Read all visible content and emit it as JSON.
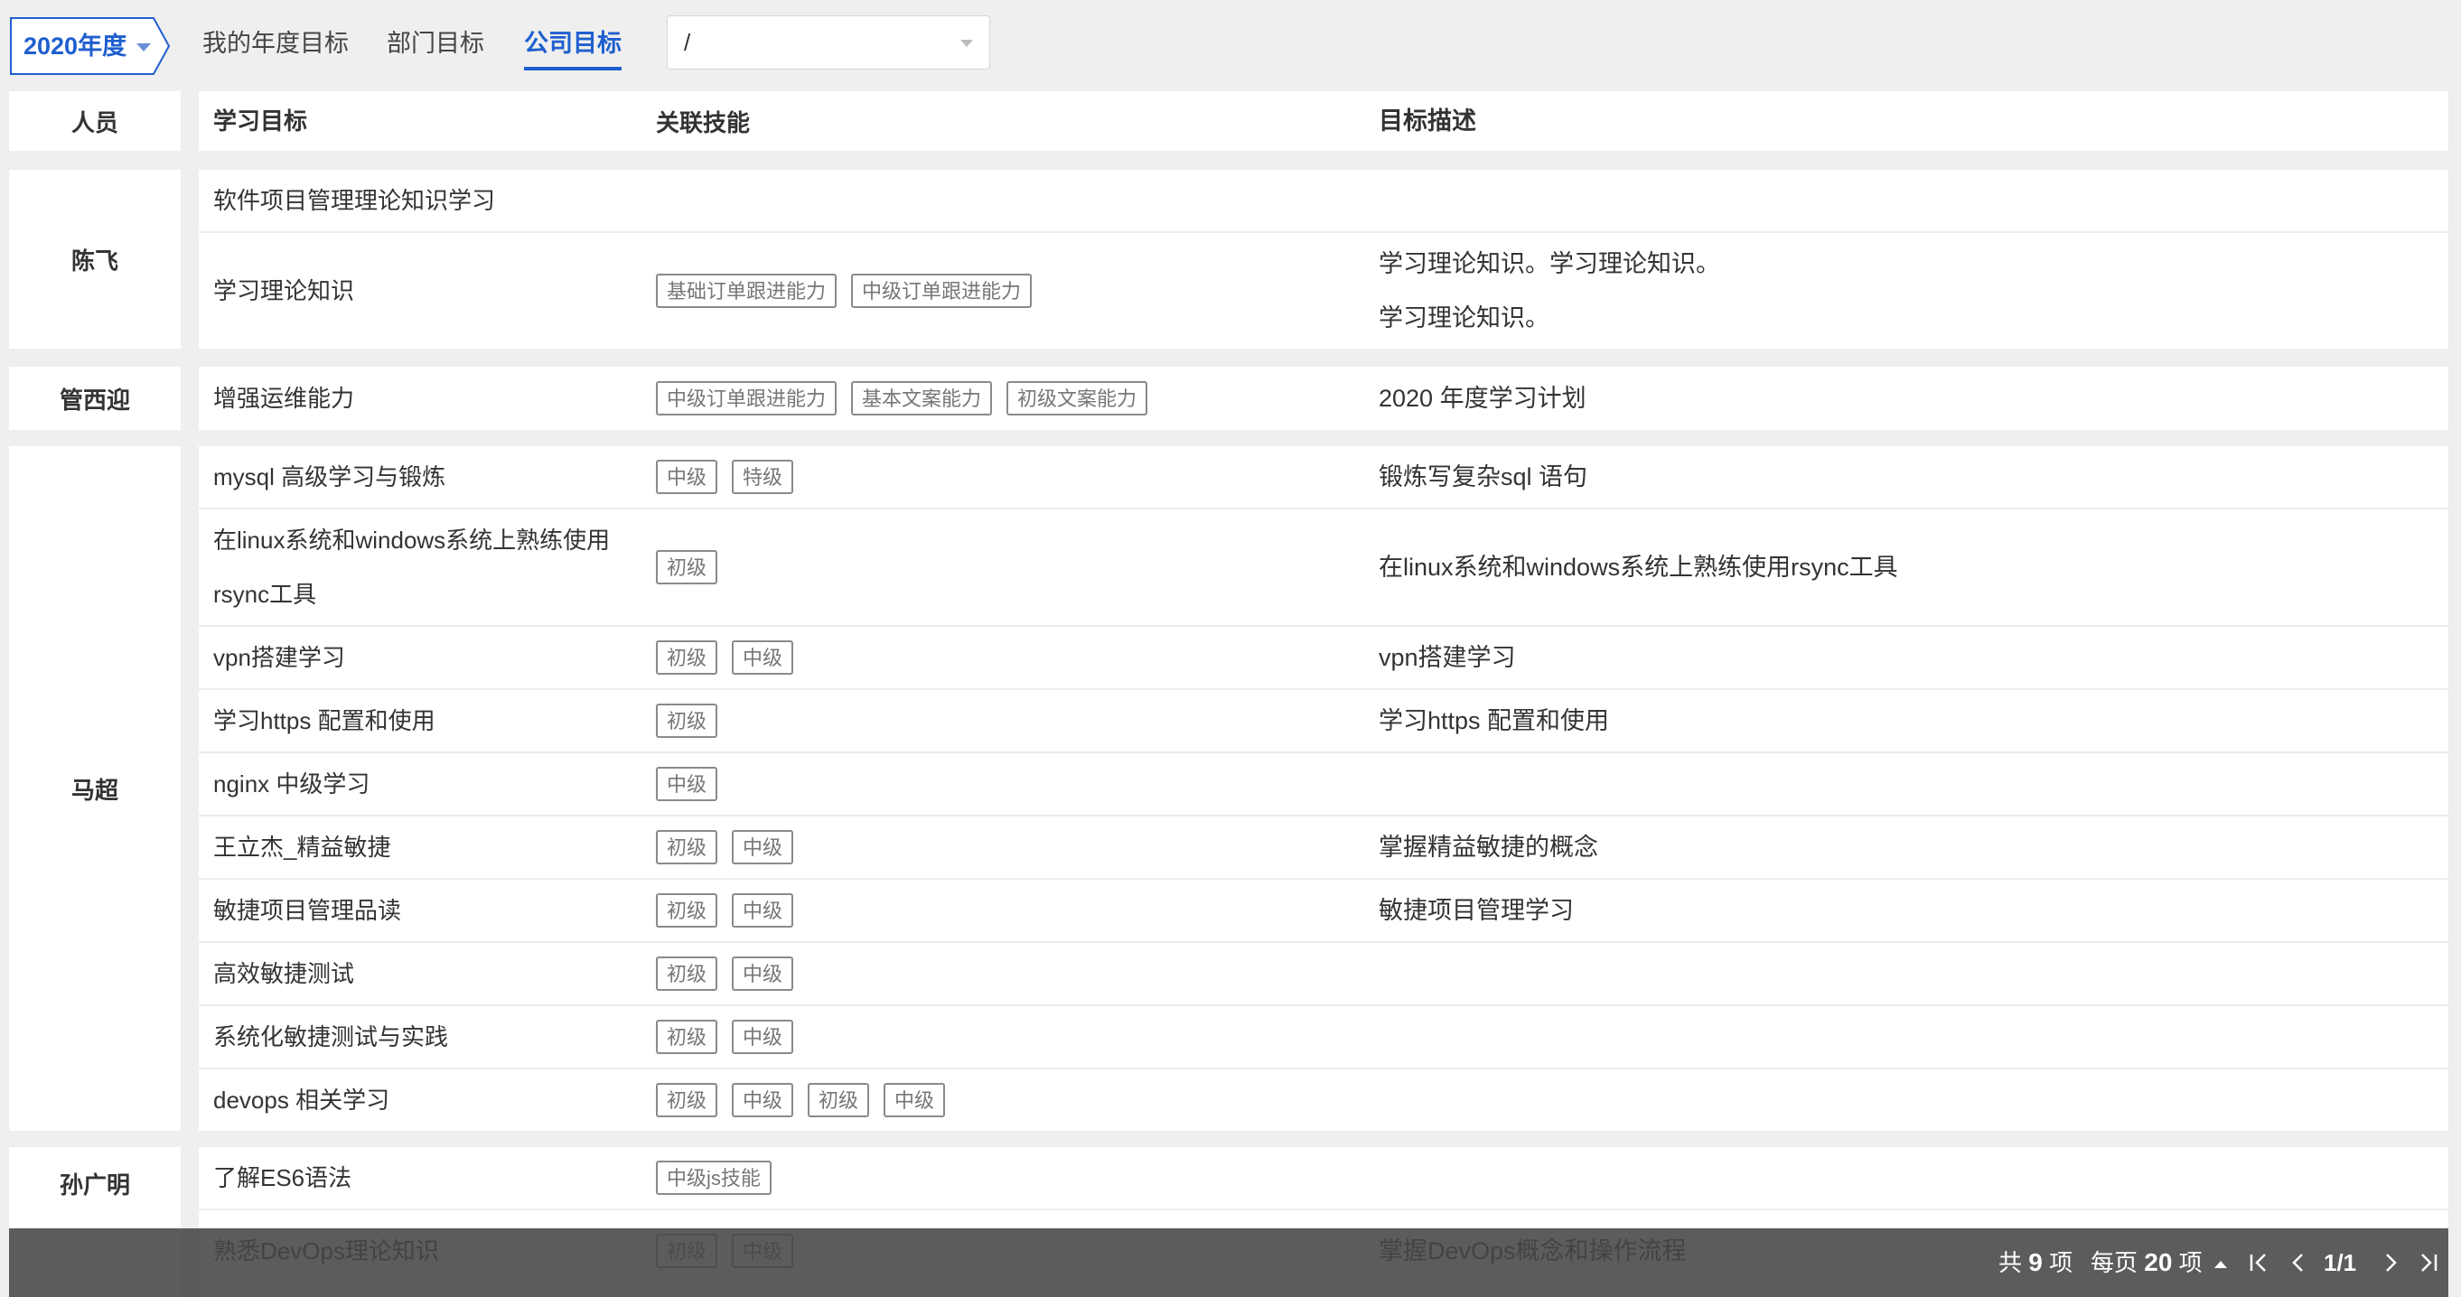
{
  "top": {
    "year": "2020年度",
    "tabs": [
      {
        "label": "我的年度目标",
        "active": false
      },
      {
        "label": "部门目标",
        "active": false
      },
      {
        "label": "公司目标",
        "active": true
      }
    ],
    "select_value": "/"
  },
  "table": {
    "headers": {
      "person": "人员",
      "goal": "学习目标",
      "skills": "关联技能",
      "desc": "目标描述"
    },
    "groups": [
      {
        "person": "陈飞",
        "rows": [
          {
            "goal": "软件项目管理理论知识学习",
            "skills": [],
            "desc": ""
          },
          {
            "goal": "学习理论知识",
            "skills": [
              "基础订单跟进能力",
              "中级订单跟进能力"
            ],
            "desc_lines": [
              "学习理论知识。学习理论知识。",
              "学习理论知识。"
            ]
          }
        ]
      },
      {
        "person": "管西迎",
        "rows": [
          {
            "goal": "增强运维能力",
            "skills": [
              "中级订单跟进能力",
              "基本文案能力",
              "初级文案能力"
            ],
            "desc": "2020 年度学习计划"
          }
        ]
      },
      {
        "person": "马超",
        "rows": [
          {
            "goal": "mysql 高级学习与锻炼",
            "skills": [
              "中级",
              "特级"
            ],
            "desc": "锻炼写复杂sql 语句"
          },
          {
            "goal_lines": [
              "在linux系统和windows系统上熟练使用",
              "rsync工具"
            ],
            "skills": [
              "初级"
            ],
            "desc": "在linux系统和windows系统上熟练使用rsync工具"
          },
          {
            "goal": "vpn搭建学习",
            "skills": [
              "初级",
              "中级"
            ],
            "desc": "vpn搭建学习"
          },
          {
            "goal": "学习https 配置和使用",
            "skills": [
              "初级"
            ],
            "desc": "学习https 配置和使用"
          },
          {
            "goal": "nginx 中级学习",
            "skills": [
              "中级"
            ],
            "desc": ""
          },
          {
            "goal": "王立杰_精益敏捷",
            "skills": [
              "初级",
              "中级"
            ],
            "desc": "掌握精益敏捷的概念"
          },
          {
            "goal": "敏捷项目管理品读",
            "skills": [
              "初级",
              "中级"
            ],
            "desc": "敏捷项目管理学习"
          },
          {
            "goal": "高效敏捷测试",
            "skills": [
              "初级",
              "中级"
            ],
            "desc": ""
          },
          {
            "goal": "系统化敏捷测试与实践",
            "skills": [
              "初级",
              "中级"
            ],
            "desc": ""
          },
          {
            "goal": "devops 相关学习",
            "skills": [
              "初级",
              "中级",
              "初级",
              "中级"
            ],
            "desc": ""
          }
        ]
      },
      {
        "person": "孙广明",
        "rows": [
          {
            "goal": "了解ES6语法",
            "skills": [
              "中级js技能"
            ],
            "desc": ""
          },
          {
            "goal": "熟悉DevOps理论知识",
            "skills": [
              "初级",
              "中级"
            ],
            "desc": "掌握DevOps概念和操作流程"
          }
        ]
      }
    ]
  },
  "pagination": {
    "total_prefix": "共",
    "total_count": "9",
    "total_suffix": "项",
    "per_page_prefix": "每页",
    "per_page_count": "20",
    "per_page_suffix": "项",
    "page_display": "1/1"
  }
}
